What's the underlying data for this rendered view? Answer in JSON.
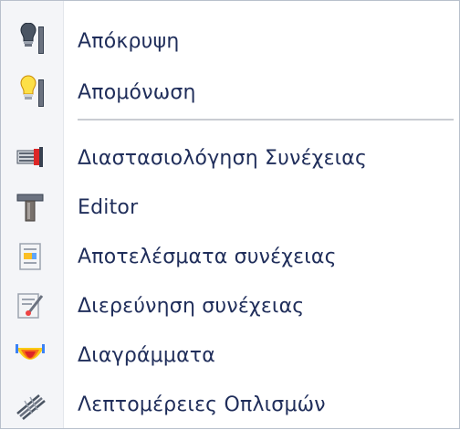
{
  "menu": {
    "groups": [
      {
        "items": [
          {
            "label": "Απόκρυψη",
            "icon": "bulb-off-icon"
          },
          {
            "label": "Απομόνωση",
            "icon": "bulb-on-icon"
          }
        ]
      },
      {
        "items": [
          {
            "label": "Διαστασιολόγηση Συνέχειας",
            "icon": "rebar-design-icon"
          },
          {
            "label": "Editor",
            "icon": "t-beam-icon"
          },
          {
            "label": "Αποτελέσματα συνέχειας",
            "icon": "results-document-icon"
          },
          {
            "label": "Διερεύνηση συνέχειας",
            "icon": "investigation-icon"
          },
          {
            "label": "Διαγράμματα",
            "icon": "diagram-icon"
          },
          {
            "label": "Λεπτομέρειες Οπλισμών",
            "icon": "reinforcement-details-icon"
          }
        ]
      }
    ]
  }
}
